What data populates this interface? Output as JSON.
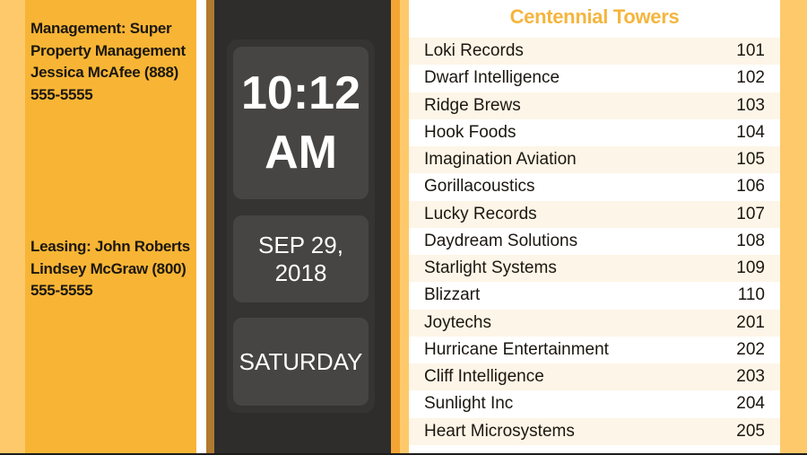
{
  "info": {
    "management": "Management: Super Property Management Jessica McAfee (888) 555-5555",
    "leasing": "Leasing: John Roberts Lindsey McGraw (800) 555-5555"
  },
  "clock": {
    "time": "10:12",
    "period": "AM",
    "date": "SEP 29, 2018",
    "day": "SATURDAY"
  },
  "directory": {
    "title": "Centennial Towers",
    "entries": [
      {
        "name": "Loki Records",
        "suite": "101"
      },
      {
        "name": "Dwarf Intelligence",
        "suite": "102"
      },
      {
        "name": "Ridge Brews",
        "suite": "103"
      },
      {
        "name": "Hook Foods",
        "suite": "104"
      },
      {
        "name": "Imagination Aviation",
        "suite": "105"
      },
      {
        "name": "Gorillacoustics",
        "suite": "106"
      },
      {
        "name": "Lucky Records",
        "suite": "107"
      },
      {
        "name": "Daydream Solutions",
        "suite": "108"
      },
      {
        "name": "Starlight Systems",
        "suite": "109"
      },
      {
        "name": "Blizzart",
        "suite": "110"
      },
      {
        "name": "Joytechs",
        "suite": "201"
      },
      {
        "name": "Hurricane Entertainment",
        "suite": "202"
      },
      {
        "name": "Cliff Intelligence",
        "suite": "203"
      },
      {
        "name": "Sunlight Inc",
        "suite": "204"
      },
      {
        "name": "Heart Microsystems",
        "suite": "205"
      }
    ]
  },
  "colors": {
    "accent_orange": "#f8b535",
    "title_orange": "#f5b53e",
    "dark_panel": "#2e2d2c"
  }
}
